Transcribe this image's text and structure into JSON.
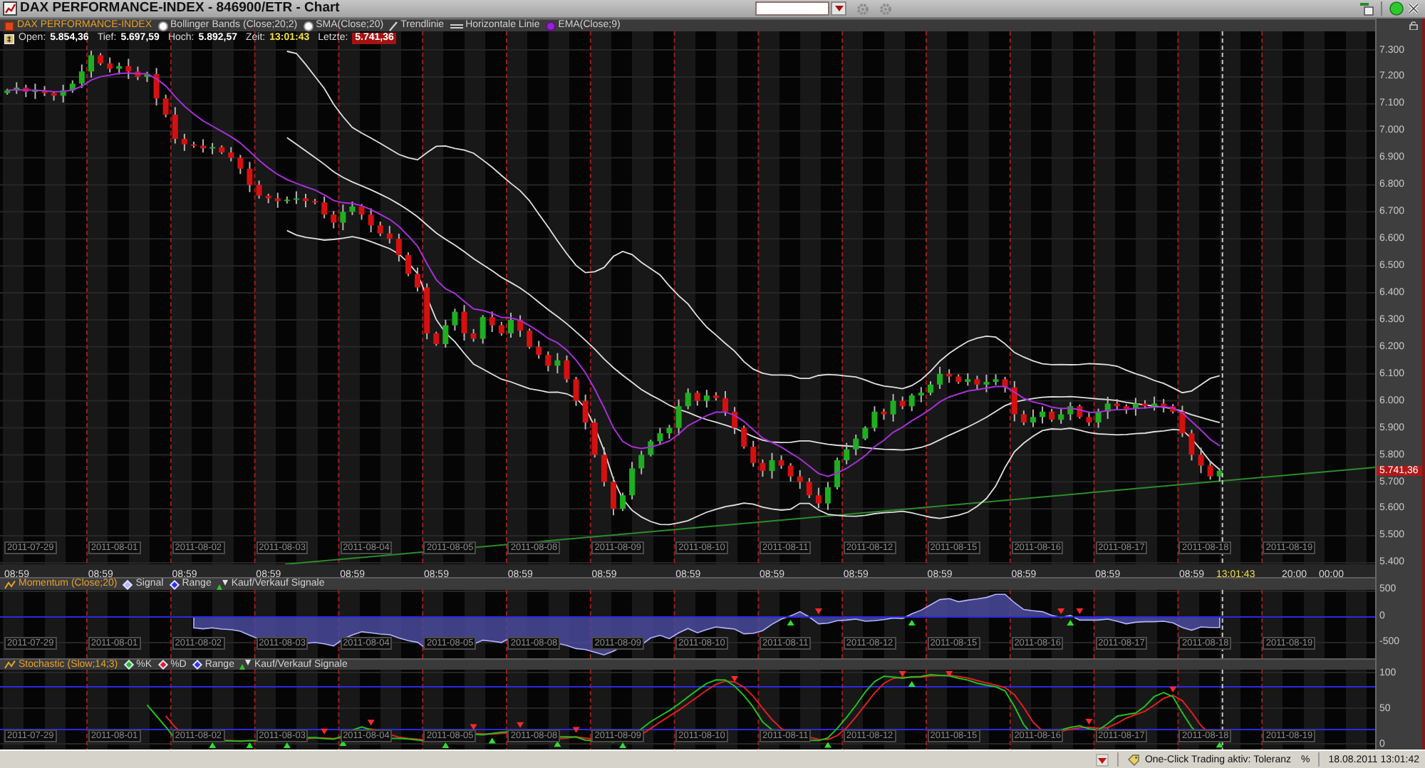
{
  "window": {
    "title": "DAX PERFORMANCE-INDEX - 846900/ETR - Chart"
  },
  "legend": [
    {
      "kind": "series",
      "label": "DAX PERFORMANCE-INDEX",
      "color": "#e04818"
    },
    {
      "kind": "indicator",
      "label": "Bollinger Bands (Close;20;2)",
      "color": "#ffffff"
    },
    {
      "kind": "indicator",
      "label": "SMA(Close;20)",
      "color": "#ffffff"
    },
    {
      "kind": "trendline",
      "label": "Trendlinie"
    },
    {
      "kind": "hline",
      "label": "Horizontale Linie"
    },
    {
      "kind": "indicator",
      "label": "EMA(Close;9)",
      "color": "#9a20d0"
    }
  ],
  "quote": [
    {
      "kind": "plain",
      "label": "Open:",
      "value": "5.854,36"
    },
    {
      "kind": "plain",
      "label": "Tief:",
      "value": "5.697,59"
    },
    {
      "kind": "plain",
      "label": "Hoch:",
      "value": "5.892,57"
    },
    {
      "kind": "time",
      "label": "Zeit:",
      "value": "13:01:43"
    },
    {
      "kind": "last",
      "label": "Letzte:",
      "value": "5.741,36"
    }
  ],
  "price_axis": [
    "7.300",
    "7.200",
    "7.100",
    "7.000",
    "6.900",
    "6.800",
    "6.700",
    "6.600",
    "6.500",
    "6.400",
    "6.300",
    "6.200",
    "6.100",
    "6.000",
    "5.900",
    "5.800",
    "5.700",
    "5.600",
    "5.500",
    "5.400"
  ],
  "last_price": "5.741,36",
  "date_labels": [
    "2011-07-29",
    "2011-08-01",
    "2011-08-02",
    "2011-08-03",
    "2011-08-04",
    "2011-08-05",
    "2011-08-08",
    "2011-08-09",
    "2011-08-10",
    "2011-08-11",
    "2011-08-12",
    "2011-08-15",
    "2011-08-16",
    "2011-08-17",
    "2011-08-18",
    "2011-08-19"
  ],
  "time_axis": [
    {
      "kind": "session",
      "text": "08:59"
    },
    {
      "kind": "session",
      "text": "08:59"
    },
    {
      "kind": "session",
      "text": "08:59"
    },
    {
      "kind": "session",
      "text": "08:59"
    },
    {
      "kind": "session",
      "text": "08:59"
    },
    {
      "kind": "session",
      "text": "08:59"
    },
    {
      "kind": "session",
      "text": "08:59"
    },
    {
      "kind": "session",
      "text": "08:59"
    },
    {
      "kind": "session",
      "text": "08:59"
    },
    {
      "kind": "session",
      "text": "08:59"
    },
    {
      "kind": "session",
      "text": "08:59"
    },
    {
      "kind": "session",
      "text": "08:59"
    },
    {
      "kind": "session",
      "text": "08:59"
    },
    {
      "kind": "session",
      "text": "08:59"
    },
    {
      "kind": "session",
      "text": "08:59"
    },
    {
      "kind": "current",
      "text": "13:01:43"
    },
    {
      "kind": "clock",
      "text": "20:00"
    },
    {
      "kind": "clock",
      "text": "00:00"
    }
  ],
  "momentum": {
    "legend": [
      {
        "kind": "indicator",
        "label": "Momentum (Close;20)"
      },
      {
        "kind": "line",
        "label": "Signal",
        "color": "#b4b4ff"
      },
      {
        "kind": "line",
        "label": "Range",
        "color": "#3030ff"
      },
      {
        "kind": "markers",
        "label": "Kauf/Verkauf Signale"
      }
    ],
    "axis": [
      "500",
      "0",
      "-500"
    ],
    "date_labels": [
      "2011-07-29",
      "2011-08-01",
      "2011-08-02",
      "2011-08-03",
      "2011-08-04",
      "2011-08-05",
      "2011-08-08",
      "2011-08-09",
      "2011-08-10",
      "2011-08-11",
      "2011-08-12",
      "2011-08-15",
      "2011-08-16",
      "2011-08-17",
      "2011-08-18",
      "2011-08-19"
    ]
  },
  "stochastic": {
    "legend": [
      {
        "kind": "indicator",
        "label": "Stochastic (Slow;14;3)"
      },
      {
        "kind": "line",
        "label": "%K",
        "color": "#20c020"
      },
      {
        "kind": "line",
        "label": "%D",
        "color": "#e02020"
      },
      {
        "kind": "line",
        "label": "Range",
        "color": "#3030ff"
      },
      {
        "kind": "markers",
        "label": "Kauf/Verkauf Signale"
      }
    ],
    "axis": [
      "100",
      "50",
      "0"
    ],
    "date_labels": [
      "2011-07-29",
      "2011-08-01",
      "2011-08-02",
      "2011-08-03",
      "2011-08-04",
      "2011-08-05",
      "2011-08-08",
      "2011-08-09",
      "2011-08-10",
      "2011-08-11",
      "2011-08-12",
      "2011-08-15",
      "2011-08-16",
      "2011-08-17",
      "2011-08-18",
      "2011-08-19"
    ]
  },
  "status_bar": {
    "trading": "One-Click Trading aktiv: Toleranz",
    "unit": "%",
    "datetime": "18.08.2011 13:01:42"
  }
}
